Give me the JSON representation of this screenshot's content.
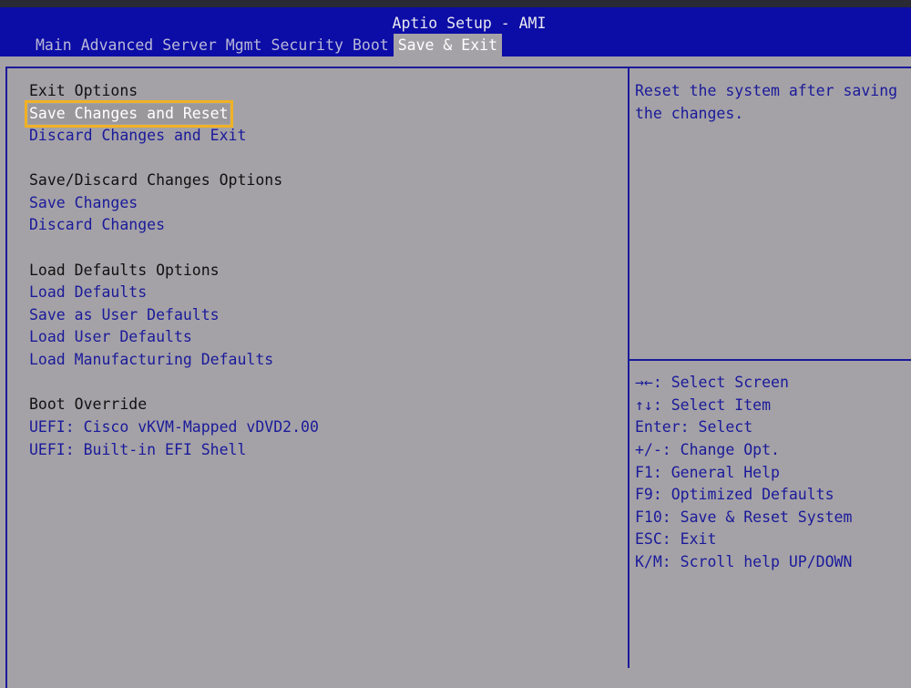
{
  "header": {
    "title": "Aptio Setup - AMI",
    "tabs": [
      "Main",
      "Advanced",
      "Server Mgmt",
      "Security",
      "Boot",
      "Save & Exit"
    ],
    "active_tab": "Save & Exit"
  },
  "menu": {
    "exit_options": "Exit Options",
    "save_changes_and_reset": "Save Changes and Reset",
    "discard_changes_and_exit": "Discard Changes and Exit",
    "save_discard_options": "Save/Discard Changes Options",
    "save_changes": "Save Changes",
    "discard_changes": "Discard Changes",
    "load_defaults_options": "Load Defaults Options",
    "load_defaults": "Load Defaults",
    "save_as_user_defaults": "Save as User Defaults",
    "load_user_defaults": "Load User Defaults",
    "load_manufacturing_defaults": "Load Manufacturing Defaults",
    "boot_override": "Boot Override",
    "boot_option_1": "UEFI: Cisco vKVM-Mapped vDVD2.00",
    "boot_option_2": "UEFI: Built-in EFI Shell"
  },
  "help": {
    "line1": "Reset the system after saving",
    "line2": "the changes."
  },
  "keys": [
    "→←: Select Screen",
    "↑↓: Select Item",
    "Enter: Select",
    "+/-: Change Opt.",
    "F1: General Help",
    "F9: Optimized Defaults",
    "F10: Save & Reset System",
    "ESC: Exit",
    "K/M: Scroll help UP/DOWN"
  ],
  "colors": {
    "header": "#0c0ca6",
    "background": "#a5a2a7",
    "text_blue": "#1a1a9a",
    "highlight_border": "#f0b224"
  }
}
